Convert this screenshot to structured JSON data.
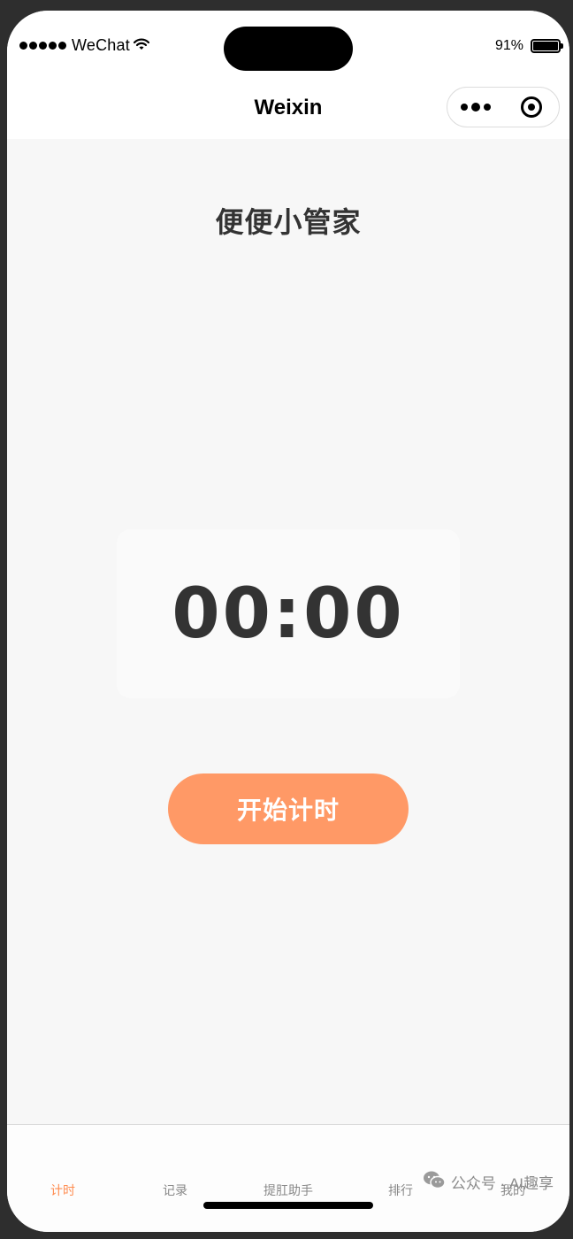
{
  "status_bar": {
    "carrier": "WeChat",
    "battery": "91%",
    "icons": [
      "signal-dots-icon",
      "wifi-icon",
      "battery-icon"
    ]
  },
  "nav": {
    "title": "Weixin",
    "capsule_icons": [
      "more-dots-icon",
      "close-target-icon"
    ]
  },
  "main": {
    "title": "便便小管家",
    "timer": "00:00",
    "start_button": "开始计时"
  },
  "tabs": [
    {
      "label": "计时",
      "active": true
    },
    {
      "label": "记录",
      "active": false
    },
    {
      "label": "提肛助手",
      "active": false
    },
    {
      "label": "排行",
      "active": false
    },
    {
      "label": "我的",
      "active": false
    }
  ],
  "watermark": {
    "text": "公众号 · AI趣享",
    "icon": "wechat-icon"
  },
  "colors": {
    "accent": "#ff9966",
    "active_tab": "#ff8c50",
    "text_dark": "#333333",
    "background": "#f7f7f7"
  }
}
